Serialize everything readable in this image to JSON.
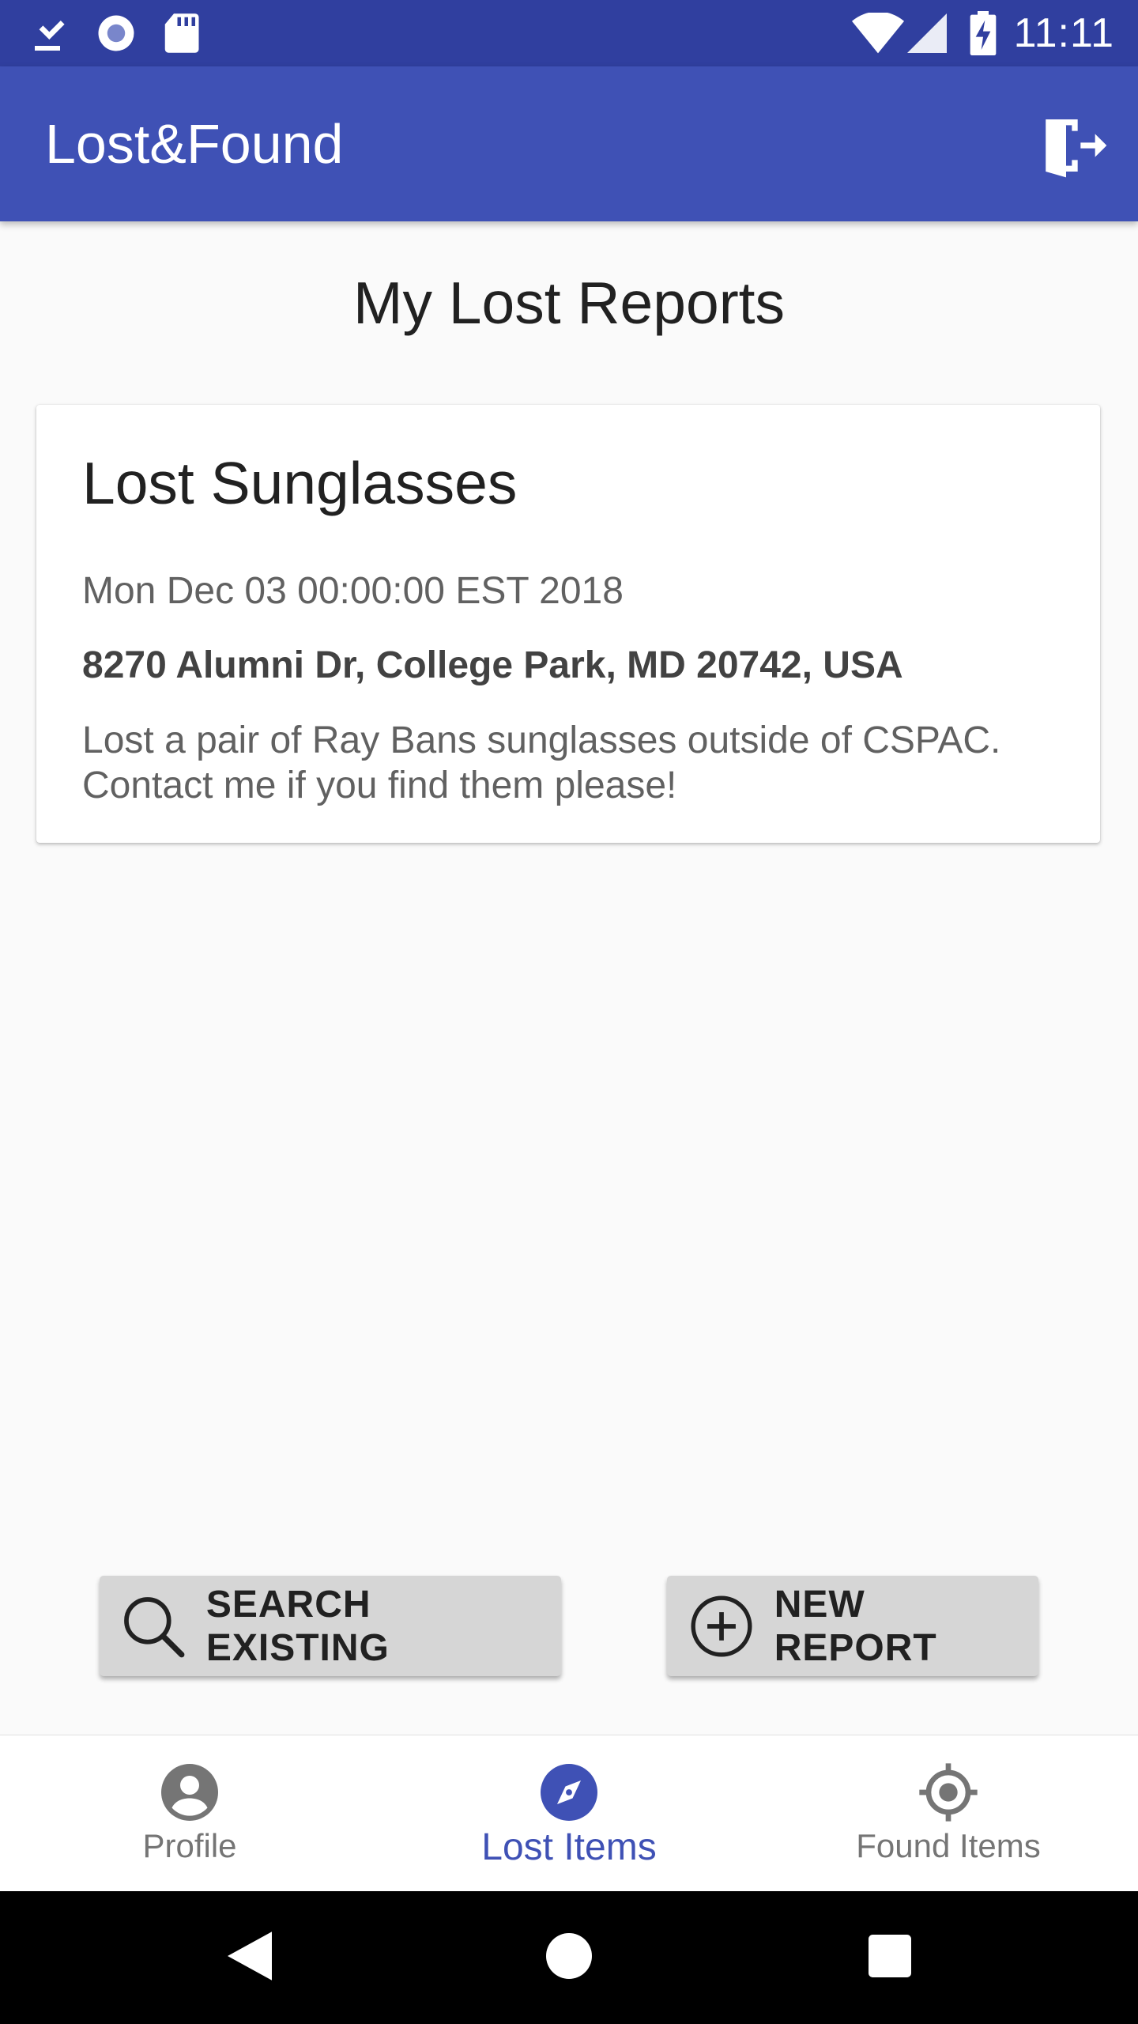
{
  "status_bar": {
    "time": "11:11",
    "icons": [
      "download-done-icon",
      "record-icon",
      "sd-card-icon",
      "wifi-icon",
      "signal-icon",
      "battery-charging-icon"
    ]
  },
  "app_bar": {
    "title": "Lost&Found",
    "logout_icon": "logout-icon"
  },
  "main": {
    "title": "My Lost Reports",
    "reports": [
      {
        "title": "Lost Sunglasses",
        "date": "Mon Dec 03 00:00:00 EST 2018",
        "address": "8270 Alumni Dr, College Park, MD 20742, USA",
        "description": "Lost a pair of Ray Bans sunglasses outside of CSPAC. Contact me if you find them please!"
      }
    ]
  },
  "actions": {
    "search_label": "SEARCH EXISTING",
    "new_label": "NEW REPORT"
  },
  "bottom_nav": {
    "items": [
      {
        "label": "Profile",
        "icon": "account-circle-icon",
        "active": false
      },
      {
        "label": "Lost Items",
        "icon": "compass-icon",
        "active": true
      },
      {
        "label": "Found Items",
        "icon": "gps-target-icon",
        "active": false
      }
    ]
  },
  "colors": {
    "primary": "#3f51b5",
    "primary_dark": "#303f9f",
    "button_bg": "#d6d6d6"
  }
}
